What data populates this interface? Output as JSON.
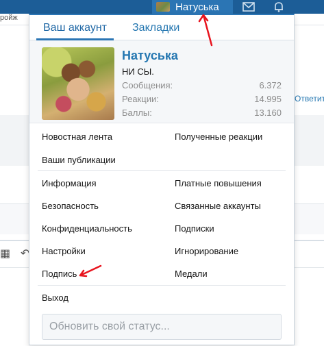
{
  "background": {
    "snippet": "ройж",
    "reply_link": "Ответить"
  },
  "topbar": {
    "username": "Натуська",
    "icons": [
      "mail-icon",
      "bell-icon"
    ]
  },
  "menu": {
    "tabs": [
      {
        "label": "Ваш аккаунт",
        "active": true
      },
      {
        "label": "Закладки",
        "active": false
      }
    ],
    "profile": {
      "name": "Натуська",
      "title": "НИ СЫ.",
      "stats": [
        {
          "label": "Сообщения:",
          "value": "6.372"
        },
        {
          "label": "Реакции:",
          "value": "14.995"
        },
        {
          "label": "Баллы:",
          "value": "13.160"
        }
      ]
    },
    "section1": {
      "left": [
        "Новостная лента",
        "Ваши публикации"
      ],
      "right": [
        "Полученные реакции"
      ]
    },
    "section2": {
      "left": [
        "Информация",
        "Безопасность",
        "Конфиденциальность",
        "Настройки",
        "Подпись"
      ],
      "right": [
        "Платные повышения",
        "Связанные аккаунты",
        "Подписки",
        "Игнорирование",
        "Медали"
      ]
    },
    "logout": "Выход",
    "status_placeholder": "Обновить свой статус..."
  },
  "colors": {
    "accent": "#2b75b4",
    "link": "#2577b1",
    "annotation": "#e8141e"
  }
}
